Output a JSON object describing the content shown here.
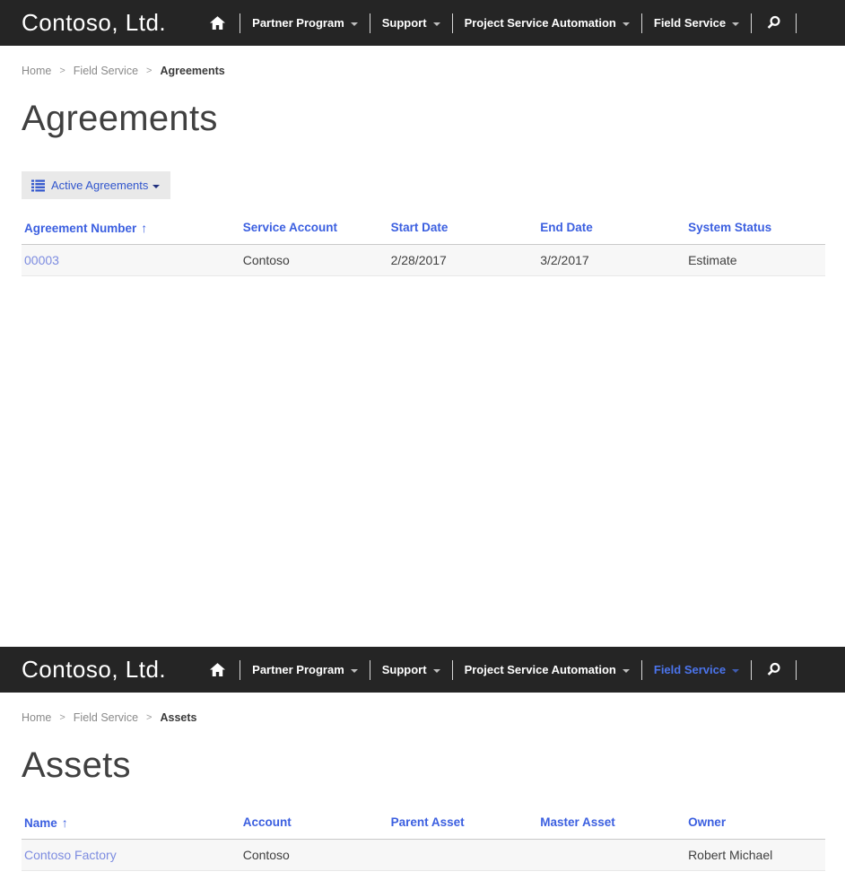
{
  "brand": "Contoso, Ltd.",
  "nav": {
    "items": [
      {
        "label": "Partner Program"
      },
      {
        "label": "Support"
      },
      {
        "label": "Project Service Automation"
      },
      {
        "label": "Field Service"
      }
    ]
  },
  "colors": {
    "navbar_bg": "#252525",
    "header_link_blue": "#3b5fe0",
    "row_link_blue": "#7d8ce0",
    "active_nav_blue": "#4b74ec",
    "button_bg": "#e9e9e9",
    "row_bg": "#f7f7f7"
  },
  "pages": [
    {
      "breadcrumb": {
        "items": [
          "Home",
          "Field Service"
        ],
        "current": "Agreements",
        "separator": ">"
      },
      "title": "Agreements",
      "view_selector": {
        "label": "Active Agreements"
      },
      "table": {
        "columns": [
          "Agreement Number",
          "Service Account",
          "Start Date",
          "End Date",
          "System Status"
        ],
        "sort_column": 0,
        "sort_icon": "↑",
        "link_columns": [
          0
        ],
        "rows": [
          [
            "00003",
            "Contoso",
            "2/28/2017",
            "3/2/2017",
            "Estimate"
          ]
        ]
      }
    },
    {
      "breadcrumb": {
        "items": [
          "Home",
          "Field Service"
        ],
        "current": "Assets",
        "separator": ">"
      },
      "title": "Assets",
      "table": {
        "columns": [
          "Name",
          "Account",
          "Parent Asset",
          "Master Asset",
          "Owner"
        ],
        "sort_column": 0,
        "sort_icon": "↑",
        "link_columns": [
          0
        ],
        "rows": [
          [
            "Contoso Factory",
            "Contoso",
            "",
            "",
            "Robert Michael"
          ]
        ]
      }
    }
  ]
}
